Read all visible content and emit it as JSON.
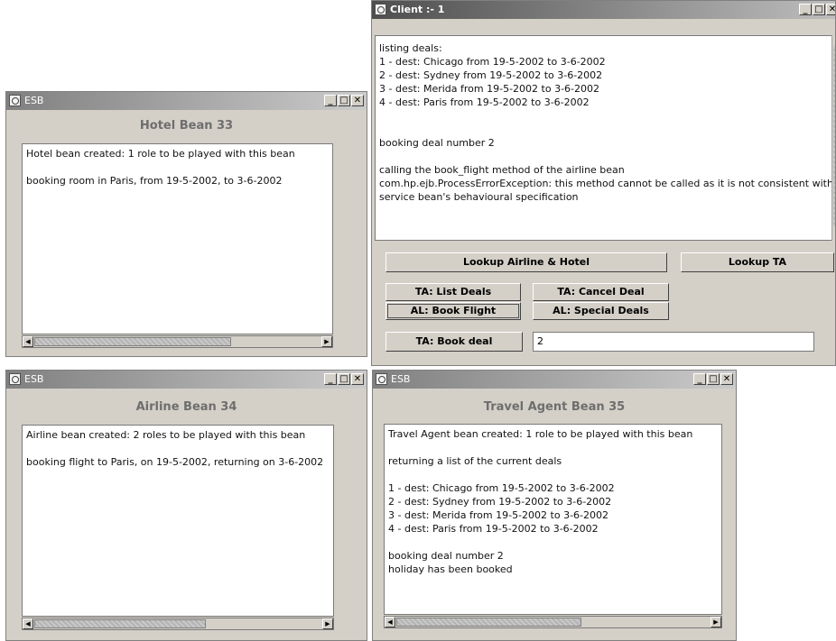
{
  "client": {
    "title": "Client :- 1",
    "log": "listing deals:\n1 - dest: Chicago from 19-5-2002 to 3-6-2002\n2 - dest: Sydney from 19-5-2002 to 3-6-2002\n3 - dest: Merida from 19-5-2002 to 3-6-2002\n4 - dest: Paris from 19-5-2002 to 3-6-2002\n\n\nbooking deal number 2\n\ncalling the book_flight method of the airline bean\ncom.hp.ejb.ProcessErrorException: this method cannot be called as it is not consistent with the\nservice bean's behavioural specification",
    "buttons": {
      "lookup_airline_hotel": "Lookup Airline & Hotel",
      "lookup_ta": "Lookup TA",
      "ta_list_deals": "TA: List Deals",
      "ta_cancel_deal": "TA: Cancel Deal",
      "al_book_flight": "AL: Book Flight",
      "al_special_deals": "AL: Special Deals",
      "ta_book_deal": "TA: Book deal"
    },
    "deal_field_value": "2"
  },
  "hotel": {
    "title": "ESB",
    "heading": "Hotel Bean 33",
    "log": "Hotel bean created: 1 role to be played with this bean\n\nbooking room in Paris, from 19-5-2002, to 3-6-2002"
  },
  "airline": {
    "title": "ESB",
    "heading": "Airline Bean 34",
    "log": "Airline bean created: 2 roles to be played with this bean\n\nbooking flight to Paris, on 19-5-2002, returning on 3-6-2002"
  },
  "travel": {
    "title": "ESB",
    "heading": "Travel Agent Bean 35",
    "log": "Travel Agent bean created: 1 role to be played with this bean\n\nreturning a list of the current deals\n\n1 - dest: Chicago from 19-5-2002 to 3-6-2002\n2 - dest: Sydney from 19-5-2002 to 3-6-2002\n3 - dest: Merida from 19-5-2002 to 3-6-2002\n4 - dest: Paris from 19-5-2002 to 3-6-2002\n\nbooking deal number 2\nholiday has been booked"
  },
  "icons": {
    "minimize": "minimize-icon",
    "maximize": "maximize-icon",
    "close": "close-icon",
    "scroll_left": "arrow-left-icon",
    "scroll_right": "arrow-right-icon",
    "app": "java-coffee-cup-icon"
  }
}
